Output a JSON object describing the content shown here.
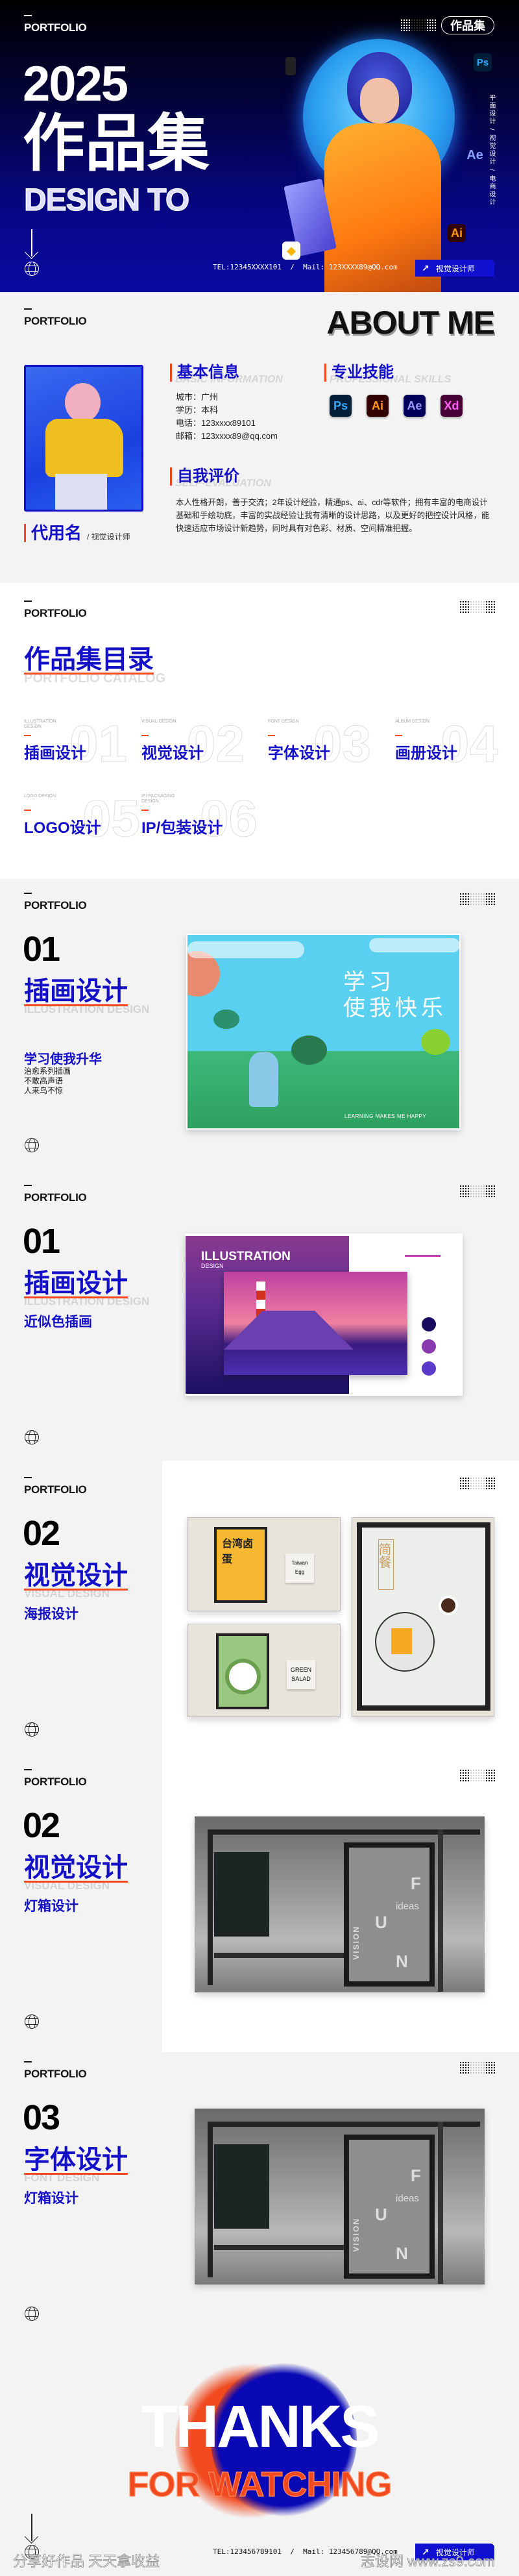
{
  "brand": {
    "logo_text": "PORTFOLIO"
  },
  "hero": {
    "badge": "作品集",
    "year": "2025",
    "title": "作品集",
    "subtitle": "DESIGN TO",
    "vertical_tags": "平面设计 / 视觉设计 / 电商设计",
    "contact": "TEL:12345XXXX101  /  Mail: 123XXXX89@QQ.com",
    "button": "视觉设计师",
    "app_icons": {
      "ps": "Ps",
      "ae": "Ae",
      "ai": "Ai"
    }
  },
  "about": {
    "title": "ABOUT ME",
    "name": "代用名",
    "role": "/ 视觉设计师",
    "basic": {
      "title": "基本信息",
      "ghost": "BASIC INFORMATION",
      "lines": [
        "城市：广州",
        "学历：本科",
        "电话：123xxxx89101",
        "邮箱：123xxxx89@qq.com"
      ]
    },
    "skills": {
      "title": "专业技能",
      "ghost": "PROFESSIONAL SKILLS",
      "icons": [
        {
          "label": "Ps",
          "bg": "#001e36",
          "fg": "#31a8ff"
        },
        {
          "label": "Ai",
          "bg": "#330000",
          "fg": "#ff9a00"
        },
        {
          "label": "Ae",
          "bg": "#00005b",
          "fg": "#9999ff"
        },
        {
          "label": "Xd",
          "bg": "#470137",
          "fg": "#ff61f6"
        }
      ]
    },
    "self": {
      "title": "自我评价",
      "ghost": "SELF-EVALUATION",
      "text": "本人性格开朗，善于交流；2年设计经验，精通ps、ai、cdr等软件；拥有丰富的电商设计基础和手绘功底，丰富的实战经验让我有清晰的设计思路，以及更好的把控设计风格，能快速适应市场设计新趋势，同时具有对色彩、材质、空间精准把握。"
    }
  },
  "catalog": {
    "title": "作品集目录",
    "ghost": "PORTFOLIO CATALOG",
    "items": [
      {
        "en": "ILLUSTRATION DESIGN",
        "title": "插画设计",
        "num": "01"
      },
      {
        "en": "VISUAL DESIGN",
        "title": "视觉设计",
        "num": "02"
      },
      {
        "en": "FONT DESIGN",
        "title": "字体设计",
        "num": "03"
      },
      {
        "en": "ALBUM DESIGN",
        "title": "画册设计",
        "num": "04"
      },
      {
        "en": "LOGO DESIGN",
        "title": "LOGO设计",
        "num": "05"
      },
      {
        "en": "IP/ PACKAGING DESIGN",
        "title": "IP/包装设计",
        "num": "06"
      }
    ]
  },
  "works": [
    {
      "num": "01",
      "title": "插画设计",
      "ghost": "ILLUSTRATION DESIGN",
      "sub": "学习使我升华",
      "lines": [
        "治愈系列插画",
        "不敢高声语",
        "人来鸟不惊"
      ],
      "art": {
        "line1": "学习",
        "line2": "使我快乐",
        "caption": "LEARNING MAKES ME HAPPY"
      }
    },
    {
      "num": "01",
      "title": "插画设计",
      "ghost": "ILLUSTRATION DESIGN",
      "sub": "近似色插画",
      "art": {
        "title": "ILLUSTRATION",
        "caption": "DESIGN",
        "swatches": [
          "#1a0a5e",
          "#8a3ab0",
          "#5a3ac8"
        ]
      }
    },
    {
      "num": "02",
      "title": "视觉设计",
      "ghost": "VISUAL DESIGN",
      "sub": "海报设计",
      "art": {
        "poster1": "台湾卤蛋",
        "sign1a": "Taiwan",
        "sign1b": "Egg",
        "sign2a": "GREEN",
        "sign2b": "SALAD",
        "poster3": "简餐"
      }
    },
    {
      "num": "02",
      "title": "视觉设计",
      "ghost": "VISUAL DESIGN",
      "sub": "灯箱设计",
      "art": {
        "f": "F",
        "u": "U",
        "n": "N",
        "ideas": "ideas",
        "vision": "VISION"
      }
    },
    {
      "num": "03",
      "title": "字体设计",
      "ghost": "FONT DESIGN",
      "sub": "灯箱设计",
      "art": {
        "f": "F",
        "u": "U",
        "n": "N",
        "ideas": "ideas",
        "vision": "VISION"
      }
    }
  ],
  "thanks": {
    "title": "THANKS",
    "subtitle": "FOR WATCHING",
    "contact": "TEL:123456789101  /  Mail: 123456789@QQ.com",
    "button": "视觉设计师"
  },
  "watermark": {
    "left": "分享好作品 天天拿收益",
    "right": "志设网 www.zs9.com"
  },
  "colors": {
    "accent_blue": "#1410c8",
    "accent_red": "#f04a1e",
    "hero_bg": "#07078a"
  }
}
